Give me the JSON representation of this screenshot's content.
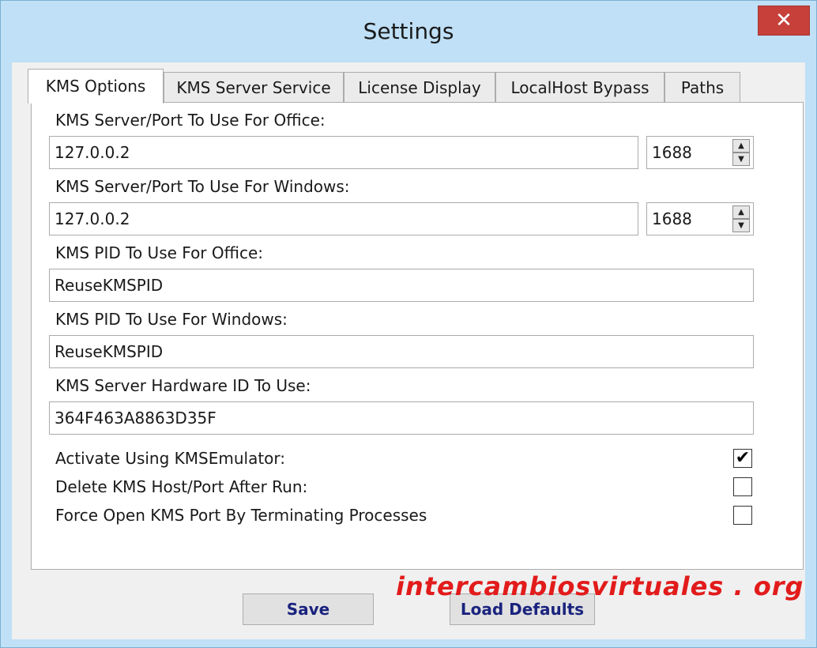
{
  "window": {
    "title": "Settings",
    "close_glyph": "✕"
  },
  "tabs": [
    {
      "label": "KMS Options",
      "active": true
    },
    {
      "label": "KMS Server Service",
      "active": false
    },
    {
      "label": "License Display",
      "active": false
    },
    {
      "label": "LocalHost Bypass",
      "active": false
    },
    {
      "label": "Paths",
      "active": false
    }
  ],
  "office_server": {
    "label": "KMS Server/Port To Use For Office:",
    "host": "127.0.0.2",
    "port": "1688"
  },
  "windows_server": {
    "label": "KMS Server/Port To Use For Windows:",
    "host": "127.0.0.2",
    "port": "1688"
  },
  "office_pid": {
    "label": "KMS PID To Use For Office:",
    "value": "ReuseKMSPID"
  },
  "windows_pid": {
    "label": "KMS PID To Use For Windows:",
    "value": "ReuseKMSPID"
  },
  "hardware_id": {
    "label": "KMS Server Hardware ID To Use:",
    "value": "364F463A8863D35F"
  },
  "options": [
    {
      "label": "Activate Using KMSEmulator:",
      "checked": true,
      "mark": "✔"
    },
    {
      "label": "Delete KMS Host/Port After Run:",
      "checked": false,
      "mark": ""
    },
    {
      "label": "Force Open KMS Port By Terminating Processes",
      "checked": false,
      "mark": ""
    }
  ],
  "buttons": {
    "save": "Save",
    "load_defaults": "Load Defaults"
  },
  "watermark": "intercambiosvirtuales . org",
  "spin": {
    "up": "▲",
    "down": "▼"
  }
}
